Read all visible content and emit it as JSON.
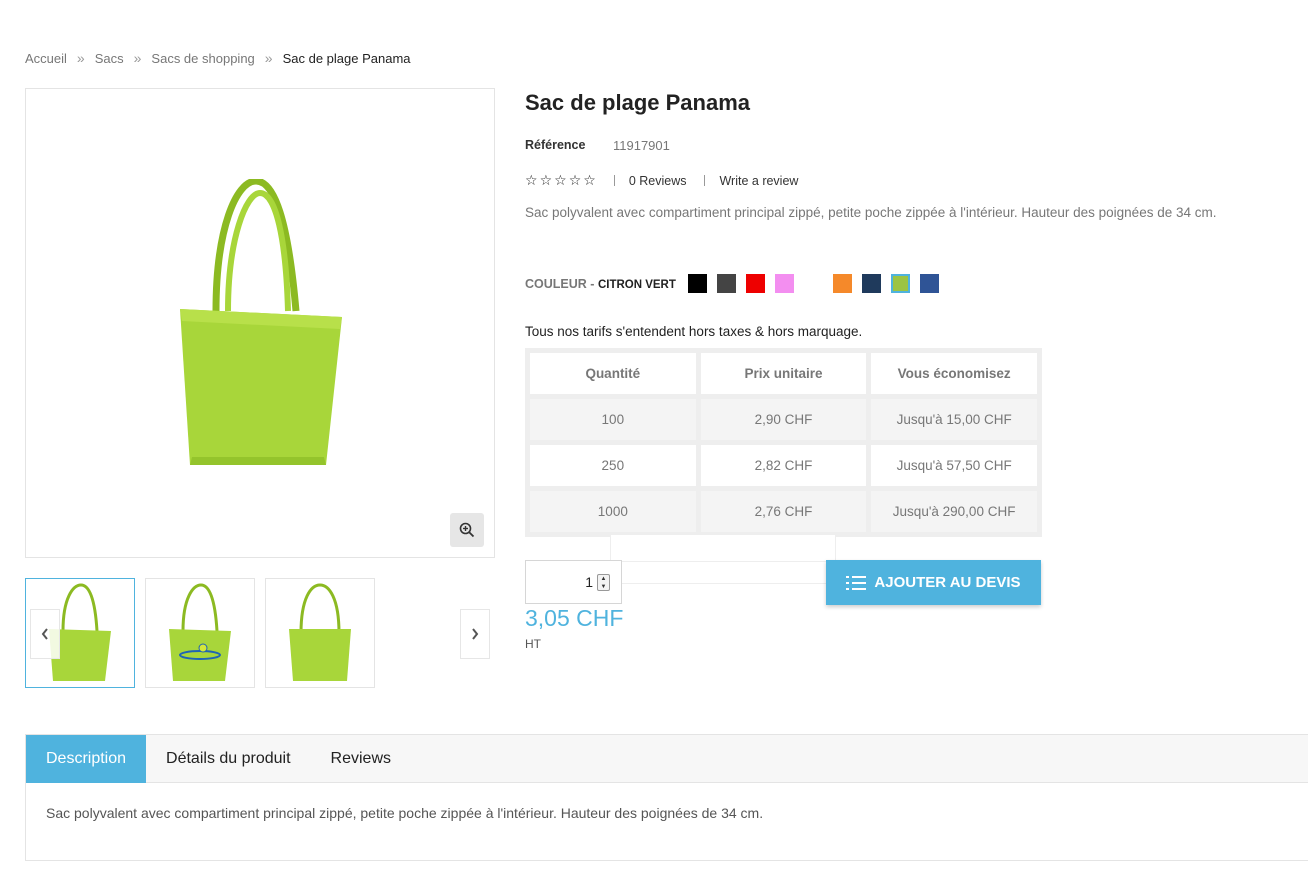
{
  "breadcrumb": {
    "items": [
      "Accueil",
      "Sacs",
      "Sacs de shopping"
    ],
    "separator": "»",
    "current": "Sac de plage Panama"
  },
  "product": {
    "title": "Sac de plage Panama",
    "reference_label": "Référence",
    "reference_value": "11917901",
    "rating": 0,
    "reviews_label": "0 Reviews",
    "write_review_label": "Write a review",
    "short_description": "Sac polyvalent avec compartiment principal zippé, petite poche zippée à l'intérieur. Hauteur des poignées de 34 cm."
  },
  "color": {
    "label": "COULEUR -",
    "selected": "CITRON VERT",
    "swatches": [
      "#000000",
      "#444444",
      "#ee0000",
      "#f38ef0",
      "blank",
      "#f5892a",
      "#1f3a5c",
      "#9cc443",
      "#2f5496"
    ],
    "selected_index": 7
  },
  "pricing": {
    "note": "Tous nos tarifs s'entendent hors taxes & hors marquage.",
    "headers": [
      "Quantité",
      "Prix unitaire",
      "Vous économisez"
    ],
    "rows": [
      [
        "100",
        "2,90 CHF",
        "Jusqu'à 15,00 CHF"
      ],
      [
        "250",
        "2,82 CHF",
        "Jusqu'à 57,50 CHF"
      ],
      [
        "1000",
        "2,76 CHF",
        "Jusqu'à 290,00 CHF"
      ]
    ]
  },
  "cart": {
    "quantity": "1",
    "add_label": "AJOUTER AU DEVIS",
    "price": "3,05 CHF",
    "price_suffix": "HT"
  },
  "tabs": {
    "items": [
      "Description",
      "Détails du produit",
      "Reviews"
    ],
    "active_index": 0,
    "content": "Sac polyvalent avec compartiment principal zippé, petite poche zippée à l'intérieur. Hauteur des poignées de 34 cm."
  },
  "colors": {
    "accent": "#4fb3de",
    "bag_green": "#a8d63a"
  },
  "icons": {
    "zoom": "zoom-in-icon",
    "prev": "chevron-left-icon",
    "next": "chevron-right-icon",
    "add": "list-icon"
  }
}
